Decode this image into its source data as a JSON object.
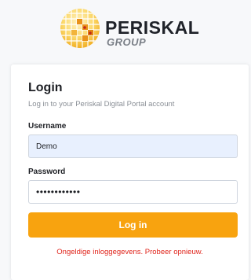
{
  "brand": {
    "name": "PERISKAL",
    "sub": "GROUP",
    "logo_icon": "globe-grid-icon",
    "colors": {
      "primary": "#f8a30f",
      "globe_light": "#fde9a6"
    }
  },
  "login": {
    "title": "Login",
    "subtitle": "Log in to your Periskal Digital Portal account",
    "username_label": "Username",
    "username_value": "Demo",
    "password_label": "Password",
    "password_value": "demopassword",
    "button_label": "Log in",
    "error_message": "Ongeldige inloggegevens. Probeer opnieuw."
  },
  "colors": {
    "button": "#f8a30f",
    "error": "#e0241b",
    "autofill": "#e8f0fe"
  }
}
